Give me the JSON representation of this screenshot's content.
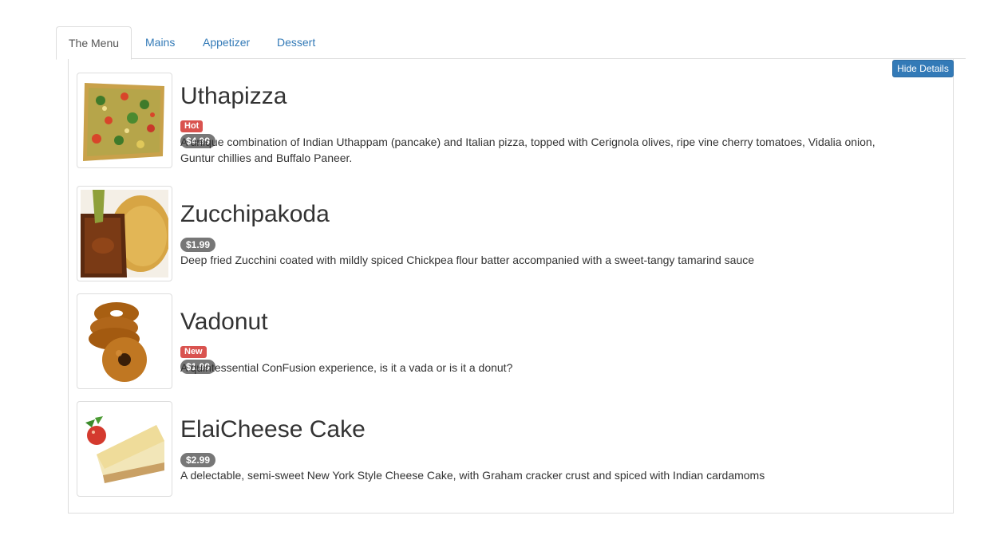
{
  "tabs": [
    {
      "label": "The Menu",
      "active": true
    },
    {
      "label": "Mains",
      "active": false
    },
    {
      "label": "Appetizer",
      "active": false
    },
    {
      "label": "Dessert",
      "active": false
    }
  ],
  "toggle_button": {
    "label": "Hide Details"
  },
  "dishes": [
    {
      "name": "Uthapizza",
      "label": "Hot",
      "price": "$4.99",
      "description": "A unique combination of Indian Uthappam (pancake) and Italian pizza, topped with Cerignola olives, ripe vine cherry tomatoes, Vidalia onion, Guntur chillies and Buffalo Paneer.",
      "image": "uthapizza-photo"
    },
    {
      "name": "Zucchipakoda",
      "label": "",
      "price": "$1.99",
      "description": "Deep fried Zucchini coated with mildly spiced Chickpea flour batter accompanied with a sweet-tangy tamarind sauce",
      "image": "zucchipakoda-photo"
    },
    {
      "name": "Vadonut",
      "label": "New",
      "price": "$1.99",
      "description": "A quintessential ConFusion experience, is it a vada or is it a donut?",
      "image": "vadonut-photo"
    },
    {
      "name": "ElaiCheese Cake",
      "label": "",
      "price": "$2.99",
      "description": "A delectable, semi-sweet New York Style Cheese Cake, with Graham cracker crust and spiced with Indian cardamoms",
      "image": "elaicheese-cake-photo"
    }
  ],
  "colors": {
    "accent": "#337ab7",
    "label_danger": "#d9534f",
    "badge": "#777777"
  }
}
